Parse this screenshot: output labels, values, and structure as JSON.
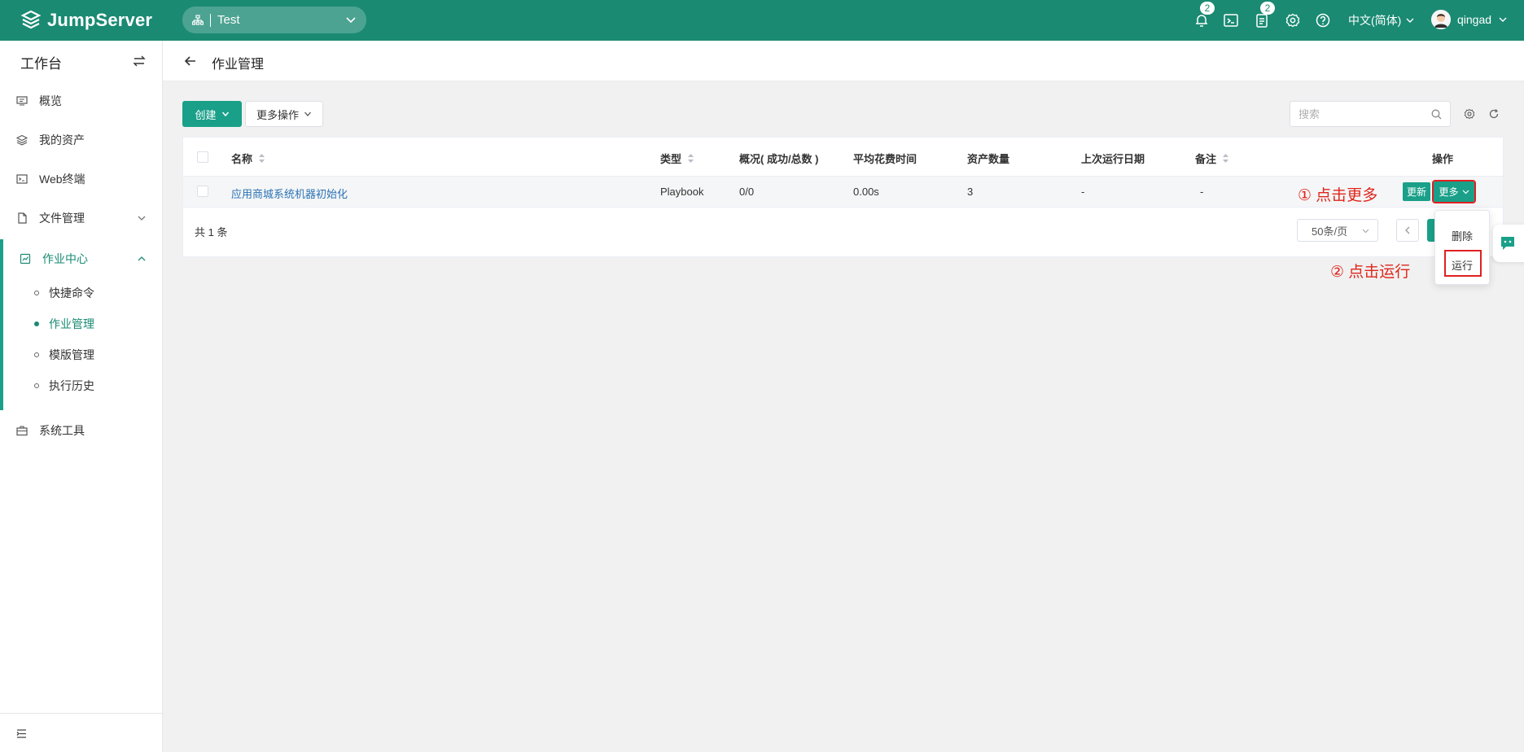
{
  "header": {
    "brand": "JumpServer",
    "org": "Test",
    "notification_badge": "2",
    "task_badge": "2",
    "language": "中文(简体)",
    "username": "qingad"
  },
  "sidebar": {
    "workspace_title": "工作台",
    "items": [
      {
        "label": "概览"
      },
      {
        "label": "我的资产"
      },
      {
        "label": "Web终端"
      },
      {
        "label": "文件管理"
      },
      {
        "label": "作业中心"
      },
      {
        "label": "系统工具"
      }
    ],
    "sub_items": [
      {
        "label": "快捷命令"
      },
      {
        "label": "作业管理"
      },
      {
        "label": "模版管理"
      },
      {
        "label": "执行历史"
      }
    ]
  },
  "page": {
    "title": "作业管理"
  },
  "toolbar": {
    "create_label": "创建",
    "more_actions_label": "更多操作",
    "search_placeholder": "搜索"
  },
  "table": {
    "columns": [
      "名称",
      "类型",
      "概况( 成功/总数 )",
      "平均花费时间",
      "资产数量",
      "上次运行日期",
      "备注",
      "操作"
    ],
    "rows": [
      {
        "name": "应用商城系统机器初始化",
        "type": "Playbook",
        "summary": "0/0",
        "avg_time": "0.00s",
        "asset_count": "3",
        "last_run": "-",
        "comment": "-",
        "update_label": "更新",
        "more_label": "更多"
      }
    ]
  },
  "pagination": {
    "total": "共 1 条",
    "page_size": "50条/页"
  },
  "dropdown": {
    "delete_label": "删除",
    "run_label": "运行"
  },
  "annotations": {
    "step1": "① 点击更多",
    "step2": "② 点击运行"
  },
  "colors": {
    "brand": "#1a8a73",
    "accent": "#1aa089",
    "annotation": "#e0251b"
  }
}
